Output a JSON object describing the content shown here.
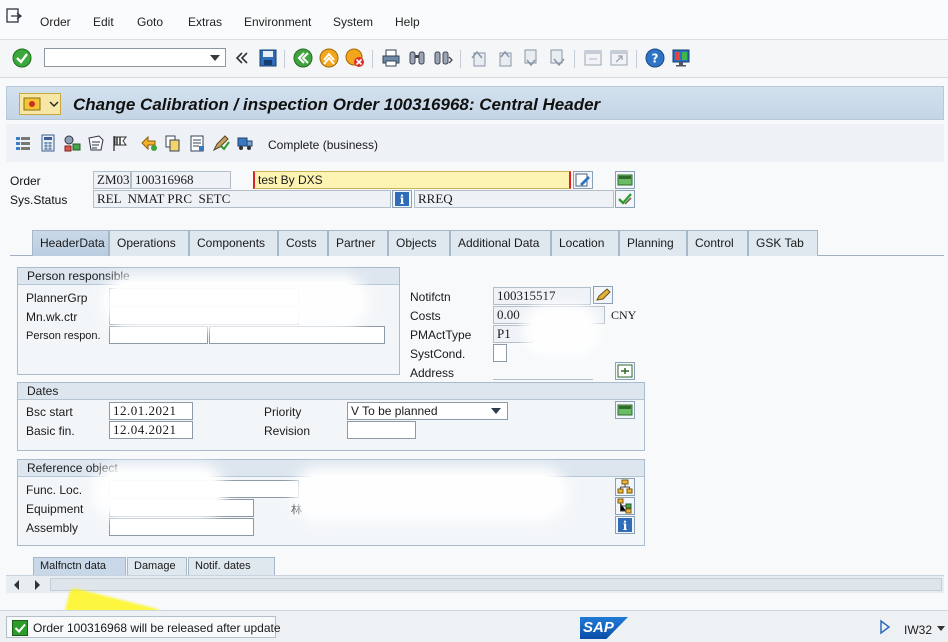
{
  "menu": {
    "items": [
      "Order",
      "Edit",
      "Goto",
      "Extras",
      "Environment",
      "System",
      "Help"
    ]
  },
  "title": "Change Calibration / inspection Order 100316968: Central Header",
  "app_toolbar": {
    "complete_label": "Complete (business)"
  },
  "header": {
    "order_label": "Order",
    "order_type": "ZM03",
    "order_number": "100316968",
    "order_text": "test By DXS",
    "sys_status_label": "Sys.Status",
    "sys_status": "REL  NMAT PRC  SETC",
    "user_status": "RREQ"
  },
  "tabs": [
    "HeaderData",
    "Operations",
    "Components",
    "Costs",
    "Partner",
    "Objects",
    "Additional Data",
    "Location",
    "Planning",
    "Control",
    "GSK Tab"
  ],
  "person_responsible": {
    "title": "Person responsible",
    "planner_grp_label": "PlannerGrp",
    "mn_wk_ctr_label": "Mn.wk.ctr",
    "person_respon_label": "Person respon.",
    "notifctn_label": "Notifctn",
    "notifctn_value": "100315517",
    "costs_label": "Costs",
    "costs_value": "0.00",
    "currency": "CNY",
    "pmacttype_label": "PMActType",
    "pmacttype_value": "P1",
    "systcond_label": "SystCond.",
    "address_label": "Address"
  },
  "dates": {
    "title": "Dates",
    "bsc_start_label": "Bsc start",
    "bsc_start_value": "12.01.2021",
    "basic_fin_label": "Basic fin.",
    "basic_fin_value": "12.04.2021",
    "priority_label": "Priority",
    "priority_value": "V To be planned",
    "revision_label": "Revision"
  },
  "reference_object": {
    "title": "Reference object",
    "func_loc_label": "Func. Loc.",
    "equipment_label": "Equipment",
    "assembly_label": "Assembly",
    "equipment_fragment": "林"
  },
  "subtabs": [
    "Malfnctn data",
    "Damage",
    "Notif. dates"
  ],
  "status": {
    "message": "Order 100316968 will be released after update"
  },
  "footer": {
    "sap_logo": "SAP",
    "tcode": "IW32"
  },
  "colors": {
    "accent": "#0a5cb8",
    "ok_green": "#2d9b2a",
    "highlight_yellow": "#fff200",
    "input_yellow": "#fdf3b2",
    "required_red": "#d22"
  }
}
